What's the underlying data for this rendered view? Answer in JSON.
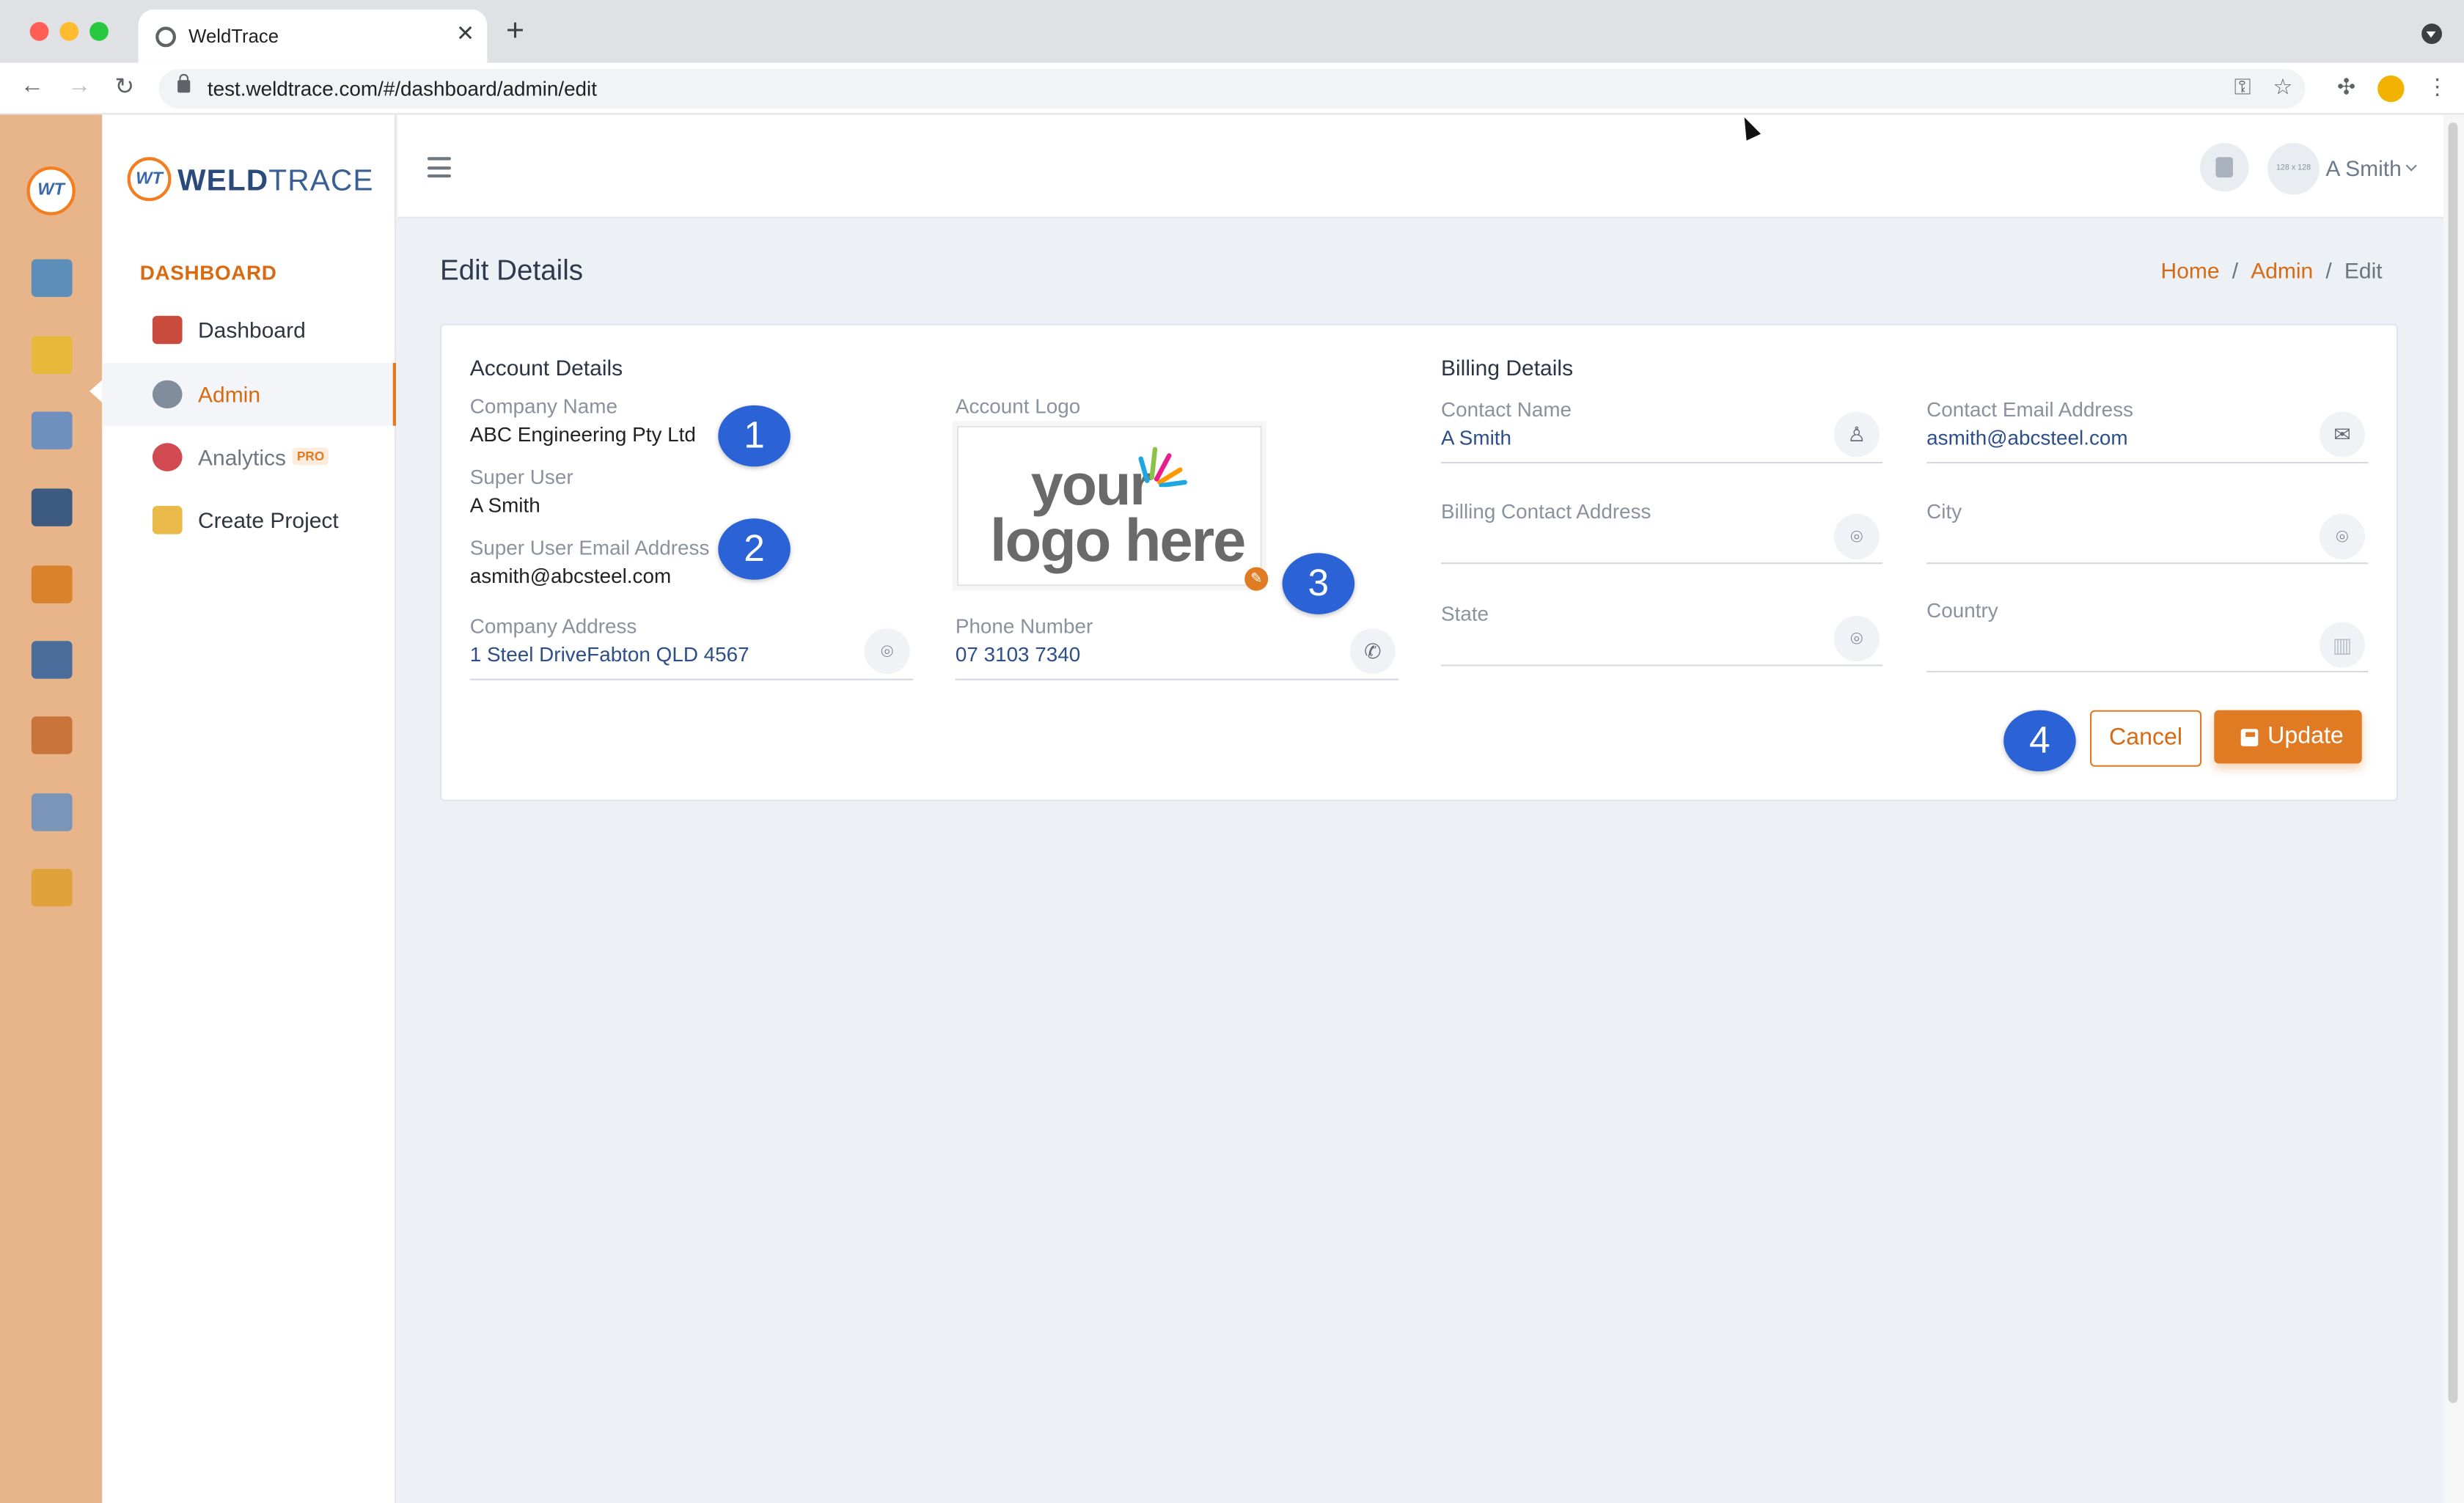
{
  "browser": {
    "tab_title": "WeldTrace",
    "url": "test.weldtrace.com/#/dashboard/admin/edit"
  },
  "brand": {
    "badge": "WT",
    "name_bold": "WELD",
    "name_light": "TRACE"
  },
  "rail": {
    "items": [
      "monitor-icon",
      "folder-settings-icon",
      "checklist-icon",
      "welder-icon",
      "org-chart-icon",
      "machine-icon",
      "team-icon",
      "report-icon",
      "certificate-icon"
    ]
  },
  "sidebar": {
    "heading": "DASHBOARD",
    "items": [
      {
        "label": "Dashboard",
        "icon": "chart-icon"
      },
      {
        "label": "Admin",
        "icon": "admin-gear-icon",
        "active": true
      },
      {
        "label": "Analytics",
        "icon": "analytics-icon",
        "badge": "PRO"
      },
      {
        "label": "Create Project",
        "icon": "folder-add-icon"
      }
    ]
  },
  "header": {
    "avatar_placeholder": "128 x 128",
    "user_name": "A Smith"
  },
  "page": {
    "title": "Edit Details",
    "breadcrumb": [
      "Home",
      "Admin",
      "Edit"
    ]
  },
  "account": {
    "section_title": "Account Details",
    "company_name_label": "Company Name",
    "company_name": "ABC Engineering Pty Ltd",
    "super_user_label": "Super User",
    "super_user": "A Smith",
    "super_user_email_label": "Super User Email Address",
    "super_user_email": "asmith@abcsteel.com",
    "company_address_label": "Company Address",
    "company_address": "1 Steel DriveFabton QLD 4567",
    "logo_label": "Account Logo",
    "logo_text_line1": "your",
    "logo_text_line2": "logo here",
    "phone_label": "Phone Number",
    "phone": "07 3103 7340"
  },
  "billing": {
    "section_title": "Billing Details",
    "contact_name_label": "Contact Name",
    "contact_name": "A Smith",
    "contact_email_label": "Contact Email Address",
    "contact_email": "asmith@abcsteel.com",
    "billing_address_label": "Billing Contact Address",
    "billing_address": "",
    "city_label": "City",
    "city": "",
    "state_label": "State",
    "state": "",
    "country_label": "Country",
    "country": ""
  },
  "annotations": [
    "1",
    "2",
    "3",
    "4"
  ],
  "actions": {
    "cancel": "Cancel",
    "update": "Update"
  },
  "colors": {
    "accent": "#e07b23",
    "rail": "#e8b48a",
    "annotation": "#2b63d6"
  }
}
